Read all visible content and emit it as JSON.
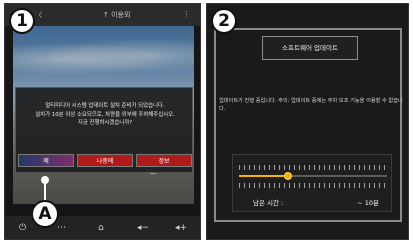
{
  "panel1": {
    "badge": "1",
    "topbar": {
      "left_item": "〈",
      "center_item": "↑ 이용외",
      "right_item": "⋮"
    },
    "dialog": {
      "message_lines": [
        "멀티미디어 시스템 업데이트 설치 준비가 되었습니다.",
        "설치가 10분 이상 소요되므로, 차량을 외부에 주차해주십시오.",
        "지금 진행하시겠습니까?"
      ],
      "buttons": {
        "yes": "예",
        "later": "나중에",
        "info": "정보"
      }
    },
    "callout": "A",
    "bottombar_icons": [
      "power-icon",
      "menu-grid-icon",
      "home-icon",
      "volume-down-icon",
      "volume-up-icon"
    ]
  },
  "panel2": {
    "badge": "2",
    "title": "소프트웨어 업데이트",
    "message": "업데이트가 진행 중입니다. 주의: 업데이트 중에는 주차 보조 기능을 이용할 수 없습니다.",
    "progress": {
      "fraction": 0.33,
      "remaining_label": "남은 시간 :",
      "remaining_value": "~ 10분"
    }
  },
  "colors": {
    "accent_red": "#b11a1a",
    "progress_yellow": "#f2b400"
  }
}
